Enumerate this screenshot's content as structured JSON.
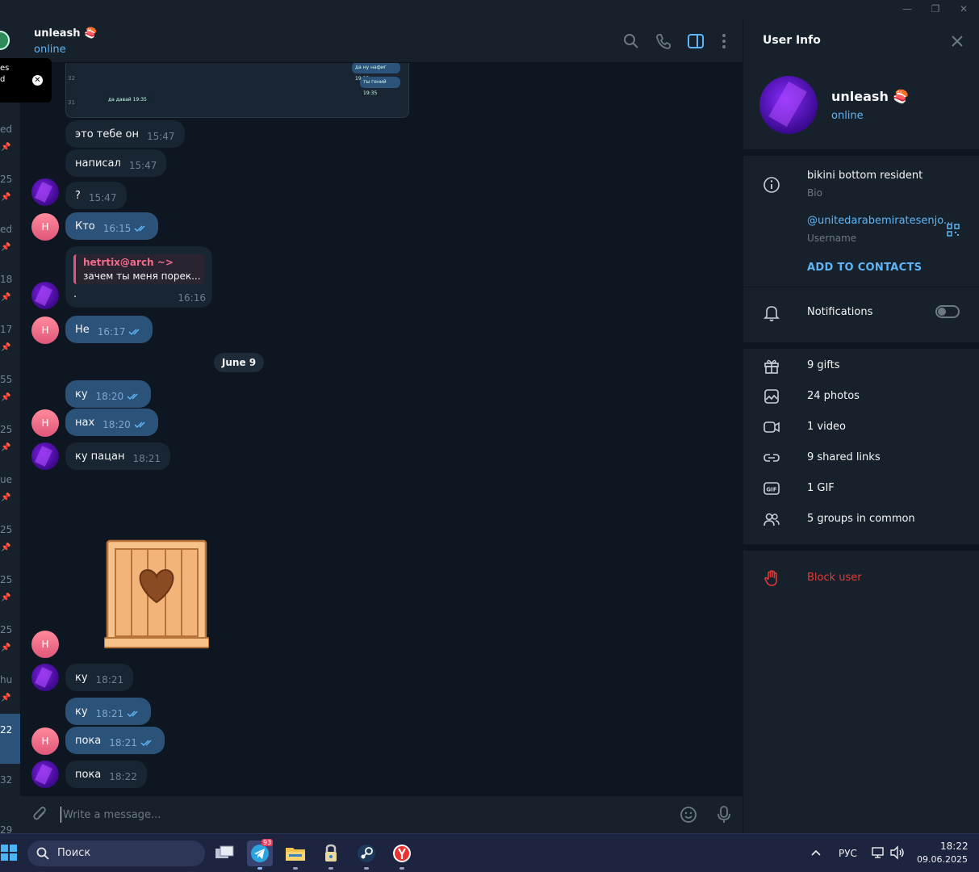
{
  "window": {
    "minimize": "—",
    "maximize": "❐",
    "close": "✕"
  },
  "left_strip": {
    "items": [
      "es",
      "d",
      "ed",
      "25",
      "ed",
      "18",
      "17",
      "55",
      "25",
      "ue",
      "25",
      "25",
      "25",
      "hu",
      "22",
      "32",
      "29"
    ]
  },
  "toast": {
    "line1": "es",
    "line2": "d"
  },
  "chat": {
    "name": "unleash 🍣",
    "status": "online"
  },
  "screenshot_preview": {
    "lines": [
      "да ну нафиг 19:35",
      "ты гений 19:35",
      "да давай 19:35"
    ],
    "line_numbers": [
      "32",
      "31"
    ]
  },
  "messages": [
    {
      "text": "это тебе он",
      "time": "15:47",
      "dir": "in"
    },
    {
      "text": "написал",
      "time": "15:47",
      "dir": "in"
    },
    {
      "text": "?",
      "time": "15:47",
      "dir": "in"
    },
    {
      "text": "Кто",
      "time": "16:15",
      "dir": "out"
    },
    {
      "text": ".",
      "time": "16:16",
      "dir": "in",
      "reply_name": "hetrtix@arch ~>",
      "reply_text": "зачем ты меня порек..."
    },
    {
      "text": "Не",
      "time": "16:17",
      "dir": "out"
    },
    {
      "text": "ку",
      "time": "18:20",
      "dir": "out"
    },
    {
      "text": "нах",
      "time": "18:20",
      "dir": "out"
    },
    {
      "text": "ку пацан",
      "time": "18:21",
      "dir": "in"
    },
    {
      "text": "ку",
      "time": "18:21",
      "dir": "in"
    },
    {
      "text": "ку",
      "time": "18:21",
      "dir": "out"
    },
    {
      "text": "пока",
      "time": "18:21",
      "dir": "out"
    },
    {
      "text": "пока",
      "time": "18:22",
      "dir": "in"
    }
  ],
  "date_separator": "June 9",
  "avatar_initial": "H",
  "composer": {
    "placeholder": "Write a message..."
  },
  "user_info": {
    "title": "User Info",
    "name": "unleash 🍣",
    "status": "online",
    "bio": "bikini bottom resident",
    "bio_label": "Bio",
    "username": "@unitedarabemiratesenjo...",
    "username_label": "Username",
    "add_contacts": "ADD TO CONTACTS",
    "notifications": "Notifications",
    "notifications_on": false,
    "media": [
      {
        "icon": "gift-icon",
        "label": "9 gifts"
      },
      {
        "icon": "photo-icon",
        "label": "24 photos"
      },
      {
        "icon": "video-icon",
        "label": "1 video"
      },
      {
        "icon": "link-icon",
        "label": "9 shared links"
      },
      {
        "icon": "gif-icon",
        "label": "1 GIF"
      },
      {
        "icon": "groups-icon",
        "label": "5 groups in common"
      }
    ],
    "block": "Block user"
  },
  "taskbar": {
    "search": "Поиск",
    "telegram_badge": "93",
    "lang": "РУС",
    "time": "18:22",
    "date": "09.06.2025"
  },
  "colors": {
    "accent": "#5eb5f7",
    "outgoing_bubble": "#2b5278",
    "incoming_bubble": "#182533",
    "danger": "#e53935",
    "background": "#0e1621"
  }
}
